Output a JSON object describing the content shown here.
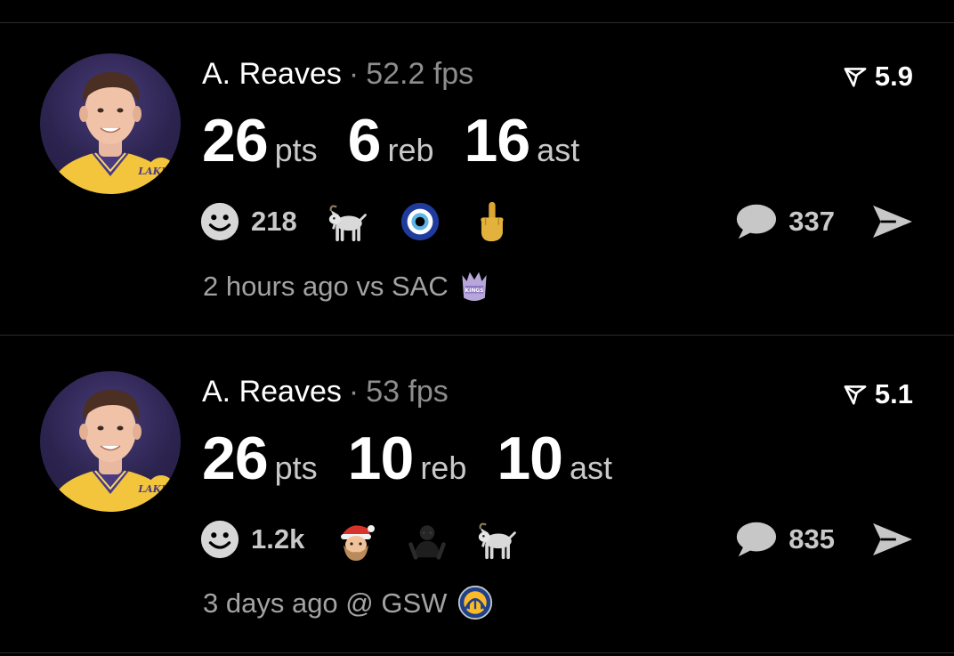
{
  "colors": {
    "background": "#000000",
    "primary_text": "#ffffff",
    "secondary_text": "#8d8d8d",
    "lakers_gold": "#f2c53d",
    "lakers_purple": "#4a3a82"
  },
  "feed": [
    {
      "player": "A. Reaves",
      "separator": "·",
      "fps": "52.2 fps",
      "score_icon": "rating-flag-icon",
      "score": "5.9",
      "stats": [
        {
          "value": "26",
          "unit": "pts"
        },
        {
          "value": "6",
          "unit": "reb"
        },
        {
          "value": "16",
          "unit": "ast"
        }
      ],
      "reaction_icon": "smiley-icon",
      "reaction_count": "218",
      "emoji_icons": [
        "goat-emoji",
        "evil-eye-emoji",
        "middle-finger-emoji"
      ],
      "comment_icon": "speech-bubble-icon",
      "comment_count": "337",
      "share_icon": "send-icon",
      "time": "2 hours ago",
      "opponent": "vs SAC",
      "opponent_logo": "kings-logo-icon"
    },
    {
      "player": "A. Reaves",
      "separator": "·",
      "fps": "53 fps",
      "score_icon": "rating-flag-icon",
      "score": "5.1",
      "stats": [
        {
          "value": "26",
          "unit": "pts"
        },
        {
          "value": "10",
          "unit": "reb"
        },
        {
          "value": "10",
          "unit": "ast"
        }
      ],
      "reaction_icon": "smiley-icon",
      "reaction_count": "1.2k",
      "emoji_icons": [
        "santa-emoji",
        "dark-figure-emoji",
        "goat-emoji"
      ],
      "comment_icon": "speech-bubble-icon",
      "comment_count": "835",
      "share_icon": "send-icon",
      "time": "3 days ago",
      "opponent": "@ GSW",
      "opponent_logo": "warriors-logo-icon"
    }
  ]
}
